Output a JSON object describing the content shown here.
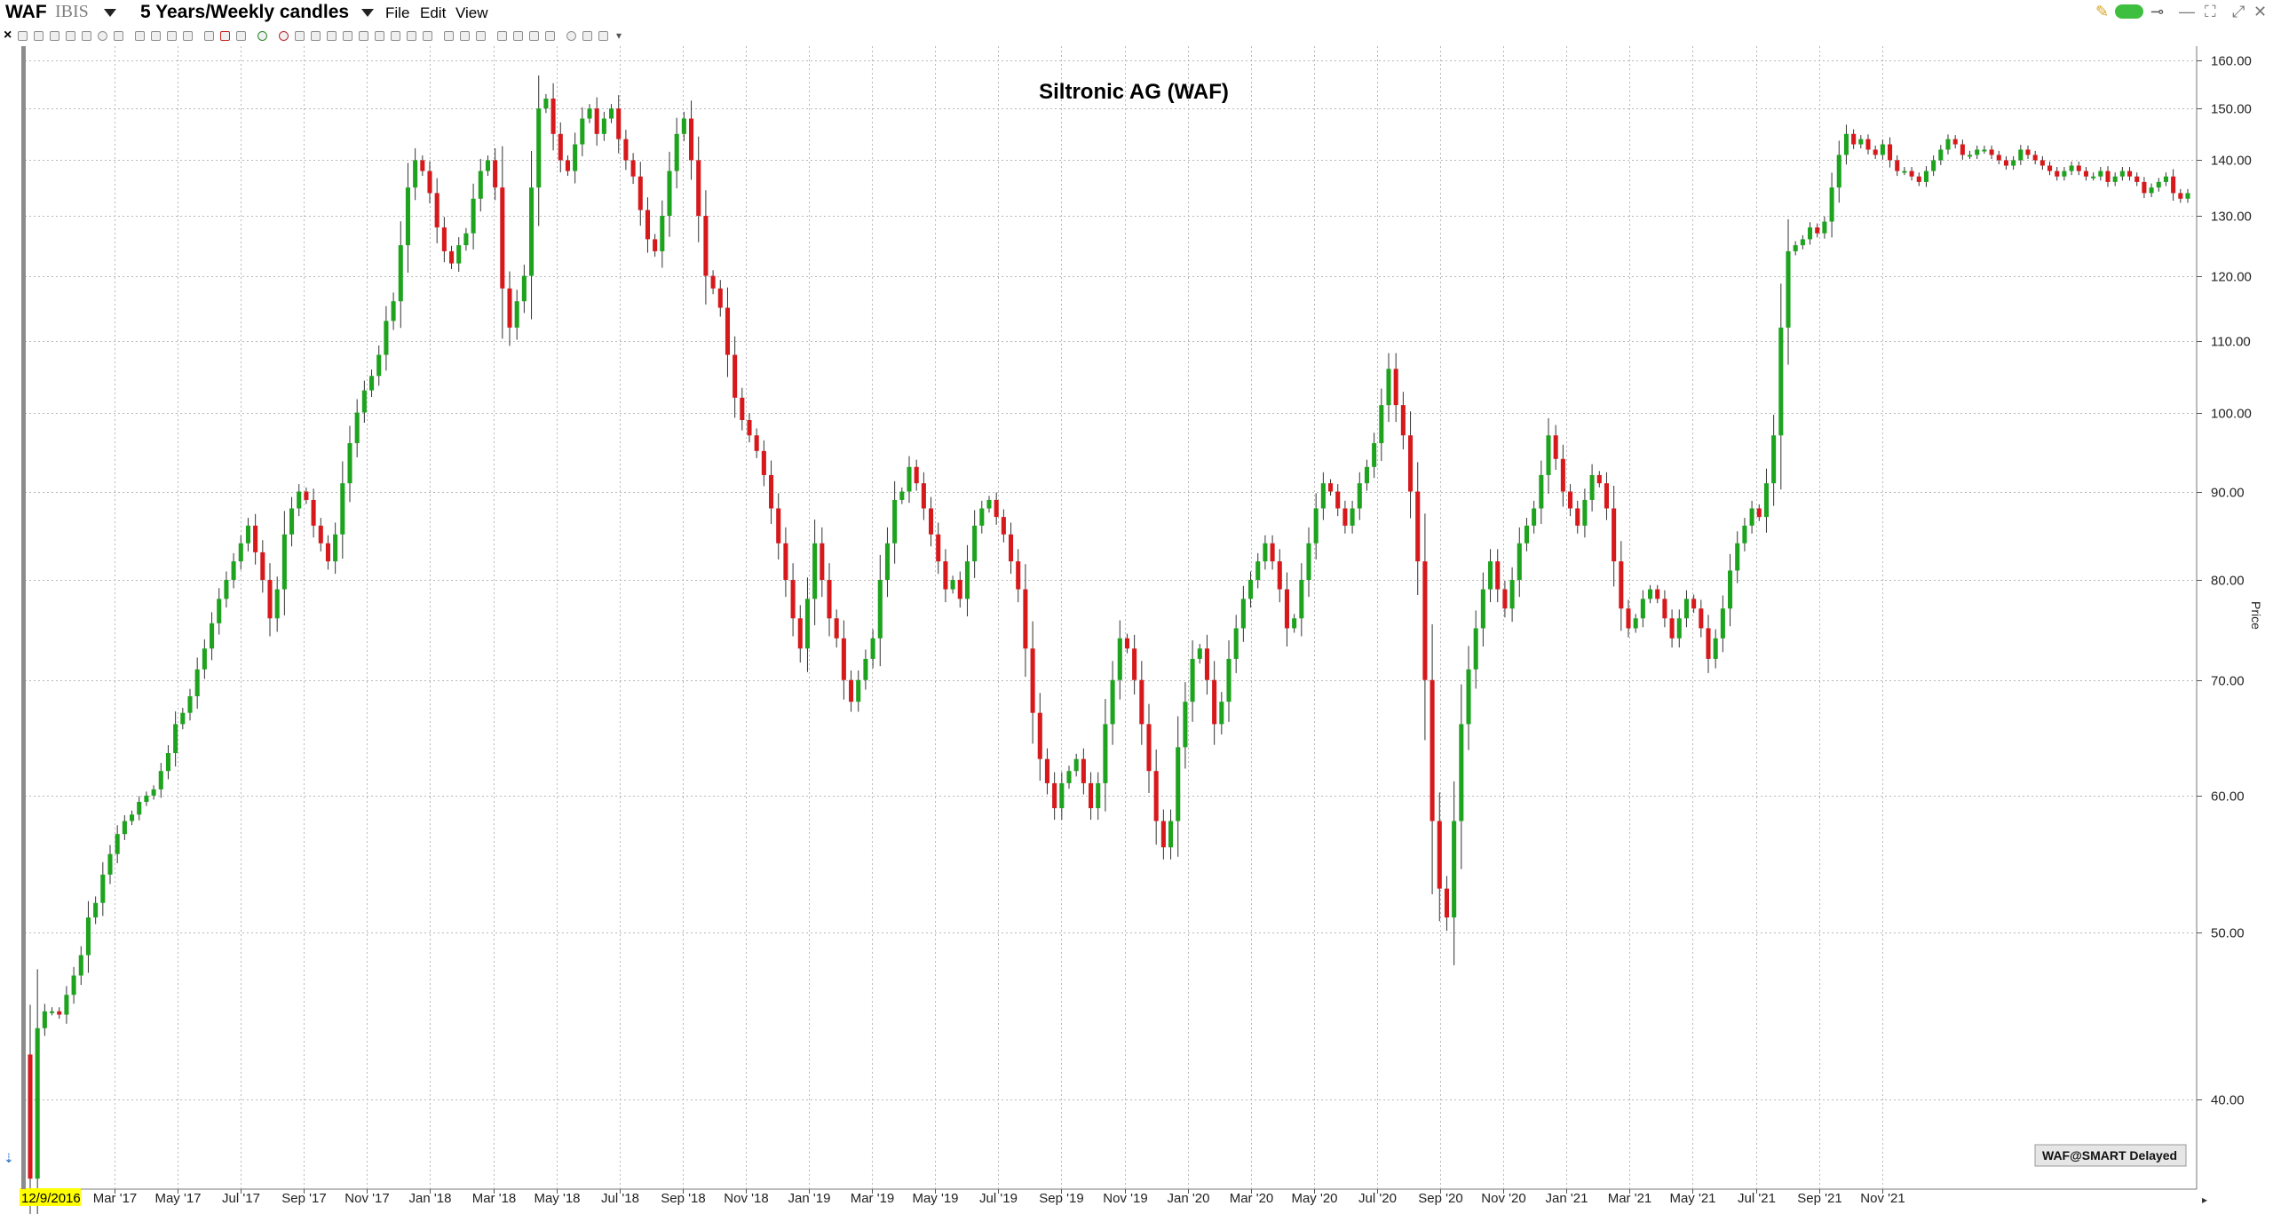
{
  "window": {
    "symbol": "WAF",
    "exchange": "IBIS",
    "period": "5 Years/Weekly candles",
    "menus": [
      "File",
      "Edit",
      "View"
    ]
  },
  "colors": {
    "up": "#1ea31e",
    "down": "#d7191c",
    "wick": "#333333",
    "grid": "#b8b8b8",
    "date_highlight": "#ffff00"
  },
  "chart_data": {
    "type": "candlestick",
    "title": "Siltronic AG (WAF)",
    "ylabel": "Price",
    "y_scale": "log",
    "ylim": [
      35.5,
      163
    ],
    "y_ticks": [
      40,
      50,
      60,
      70,
      80,
      90,
      100,
      110,
      120,
      130,
      140,
      150,
      160
    ],
    "y_tick_labels": [
      "40.00",
      "50.00",
      "60.00",
      "70.00",
      "80.00",
      "90.00",
      "100.00",
      "110.00",
      "120.00",
      "130.00",
      "140.00",
      "150.00",
      "160.00"
    ],
    "x_start_label": "12/9/2016",
    "x_tick_labels": [
      "Mar '17",
      "May '17",
      "Jul '17",
      "Sep '17",
      "Nov '17",
      "Jan '18",
      "Mar '18",
      "May '18",
      "Jul '18",
      "Sep '18",
      "Nov '18",
      "Jan '19",
      "Mar '19",
      "May '19",
      "Jul '19",
      "Sep '19",
      "Nov '19",
      "Jan '20",
      "Mar '20",
      "May '20",
      "Jul '20",
      "Sep '20",
      "Nov '20",
      "Jan '21",
      "Mar '21",
      "May '21",
      "Jul '21",
      "Sep '21",
      "Nov '21"
    ],
    "series_note": "weekly close",
    "closes": [
      36.0,
      44.0,
      45.0,
      45.0,
      44.8,
      46.0,
      47.2,
      48.5,
      51.0,
      52.0,
      54.0,
      55.5,
      57.0,
      58.0,
      58.5,
      59.5,
      60.0,
      60.5,
      62.0,
      63.5,
      66.0,
      67.0,
      68.5,
      71.0,
      73.0,
      75.5,
      78.0,
      80.0,
      82.0,
      84.0,
      86.0,
      83.0,
      80.0,
      76.0,
      79.0,
      85.0,
      88.0,
      90.0,
      89.0,
      86.0,
      84.0,
      82.0,
      85.0,
      91.0,
      96.0,
      100.0,
      103.0,
      105.0,
      108.0,
      113.0,
      116.0,
      125.0,
      135.0,
      140.0,
      138.0,
      134.0,
      128.0,
      124.0,
      122.0,
      125.0,
      127.0,
      133.0,
      138.0,
      140.0,
      135.0,
      118.0,
      112.0,
      116.0,
      120.0,
      135.0,
      150.0,
      152.0,
      145.0,
      140.0,
      138.0,
      143.0,
      148.0,
      150.0,
      145.0,
      148.0,
      150.0,
      144.0,
      140.0,
      137.0,
      131.0,
      126.0,
      124.0,
      130.0,
      138.0,
      145.0,
      148.0,
      140.0,
      130.0,
      120.0,
      118.0,
      115.0,
      108.0,
      102.0,
      99.0,
      97.0,
      95.0,
      92.0,
      88.0,
      84.0,
      80.0,
      76.0,
      73.0,
      78.0,
      84.0,
      80.0,
      76.0,
      74.0,
      70.0,
      68.0,
      70.0,
      72.0,
      74.0,
      80.0,
      84.0,
      89.0,
      90.0,
      93.0,
      91.0,
      88.0,
      85.0,
      82.0,
      79.0,
      80.0,
      78.0,
      82.0,
      86.0,
      88.0,
      89.0,
      87.0,
      85.0,
      82.0,
      79.0,
      73.0,
      67.0,
      63.0,
      61.0,
      59.0,
      61.0,
      62.0,
      63.0,
      61.0,
      59.0,
      61.0,
      66.0,
      70.0,
      74.0,
      73.0,
      70.0,
      66.0,
      62.0,
      58.0,
      56.0,
      58.0,
      64.0,
      68.0,
      72.0,
      73.0,
      70.0,
      66.0,
      68.0,
      72.0,
      75.0,
      78.0,
      80.0,
      82.0,
      84.0,
      82.0,
      79.0,
      75.0,
      76.0,
      80.0,
      84.0,
      88.0,
      91.0,
      90.0,
      88.0,
      86.0,
      88.0,
      91.0,
      93.0,
      96.0,
      101.0,
      106.0,
      101.0,
      97.0,
      90.0,
      82.0,
      70.0,
      58.0,
      53.0,
      51.0,
      58.0,
      66.0,
      71.0,
      75.0,
      79.0,
      82.0,
      79.0,
      77.0,
      80.0,
      84.0,
      86.0,
      88.0,
      92.0,
      97.0,
      94.0,
      90.0,
      88.0,
      86.0,
      89.0,
      92.0,
      91.0,
      88.0,
      82.0,
      77.0,
      75.0,
      76.0,
      78.0,
      79.0,
      78.0,
      76.0,
      74.0,
      76.0,
      78.0,
      77.0,
      75.0,
      72.0,
      74.0,
      77.0,
      81.0,
      84.0,
      86.0,
      88.0,
      87.0,
      91.0,
      97.0,
      112.0,
      124.0,
      125.0,
      126.0,
      128.0,
      127.0,
      129.0,
      135.0,
      141.0,
      145.0,
      143.0,
      144.0,
      142.0,
      141.0,
      143.0,
      140.0,
      138.0,
      138.0,
      137.0,
      136.0,
      138.0,
      140.0,
      142.0,
      144.0,
      143.0,
      141.0,
      141.0,
      142.0,
      142.0,
      141.0,
      140.0,
      139.0,
      140.0,
      142.0,
      141.0,
      140.0,
      139.0,
      138.0,
      137.0,
      138.0,
      139.0,
      138.0,
      137.0,
      137.0,
      138.0,
      136.0,
      137.0,
      138.0,
      137.0,
      136.0,
      134.0,
      135.0,
      136.0,
      137.0,
      134.0,
      133.0,
      134.0
    ]
  },
  "badge": {
    "text": "WAF@SMART Delayed"
  }
}
